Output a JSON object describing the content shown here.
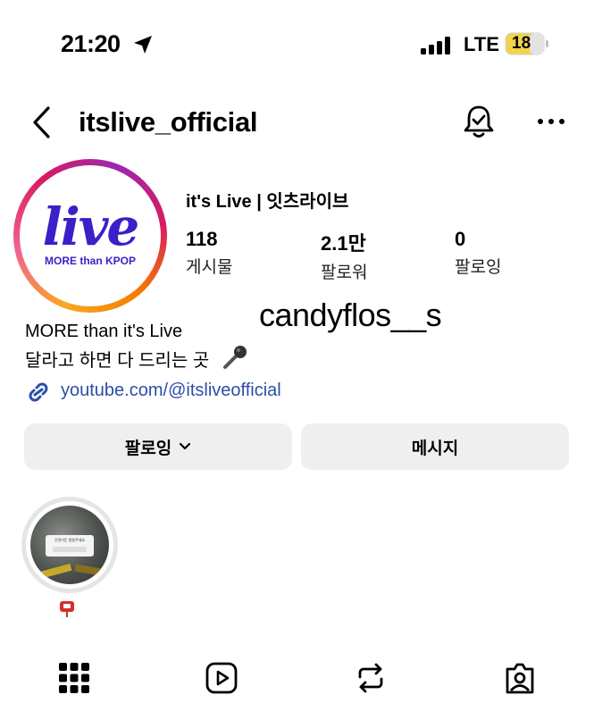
{
  "status_bar": {
    "time": "21:20",
    "network": "LTE",
    "battery": "18"
  },
  "header": {
    "username": "itslive_official"
  },
  "profile": {
    "display_name": "it's Live | 잇츠라이브",
    "logo_text": "live",
    "logo_subtext": "MORE than KPOP",
    "stats": [
      {
        "value": "118",
        "label": "게시물"
      },
      {
        "value": "2.1만",
        "label": "팔로워"
      },
      {
        "value": "0",
        "label": "팔로잉"
      }
    ],
    "bio_line1": "MORE than it's Live",
    "bio_line2": "달라고 하면 다 드리는 곳",
    "link": "youtube.com/@itsliveofficial"
  },
  "watermark": "candyflos__s",
  "actions": {
    "following_label": "팔로잉",
    "message_label": "메시지"
  },
  "highlight": {
    "card_text": "무엇이든 말씀주세요"
  },
  "tabs": [
    "grid-icon",
    "reels-icon",
    "reposts-icon",
    "tagged-icon"
  ],
  "colors": {
    "link": "#2b4ea8",
    "brand": "#3b1fc8",
    "button_bg": "#efefef"
  }
}
